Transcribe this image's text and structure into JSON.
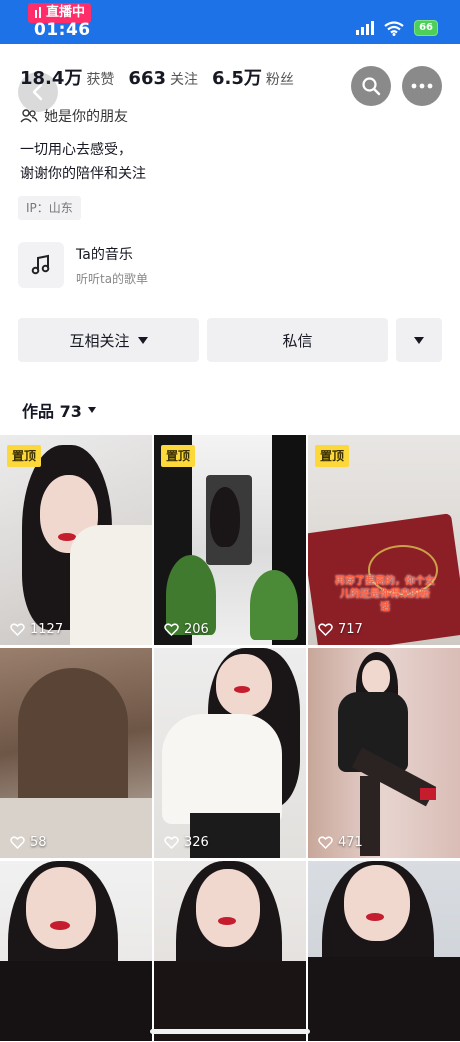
{
  "status": {
    "live_label": "直播中",
    "time": "01:46",
    "battery": "66"
  },
  "profile": {
    "stats": [
      {
        "value": "18.4万",
        "label": "获赞"
      },
      {
        "value": "663",
        "label": "关注"
      },
      {
        "value": "6.5万",
        "label": "粉丝"
      }
    ],
    "relation": "她是你的朋友",
    "bio_line1": "一切用心去感受，",
    "bio_line2": "谢谢你的陪伴和关注",
    "ip": "IP：山东"
  },
  "music": {
    "title": "Ta的音乐",
    "subtitle": "听听ta的歌单"
  },
  "actions": {
    "follow_back": "互相关注",
    "message": "私信"
  },
  "works": {
    "label": "作品 73"
  },
  "grid": {
    "pinned_label": "置顶",
    "overlay_text_line1": "再穿了要离的，你个女",
    "overlay_text_line2": "儿的还是你得来的新",
    "overlay_text_line3": "话",
    "tiles": [
      {
        "likes": "1127",
        "pinned": true
      },
      {
        "likes": "206",
        "pinned": true
      },
      {
        "likes": "717",
        "pinned": true
      },
      {
        "likes": "58",
        "pinned": false
      },
      {
        "likes": "326",
        "pinned": false
      },
      {
        "likes": "471",
        "pinned": false
      },
      {
        "likes": "",
        "pinned": false
      },
      {
        "likes": "",
        "pinned": false
      },
      {
        "likes": "",
        "pinned": false
      }
    ]
  },
  "colors": {
    "status_bar": "#1e72e8",
    "live_pill": "#ff2e6b",
    "pin_badge": "#fdd83b"
  }
}
